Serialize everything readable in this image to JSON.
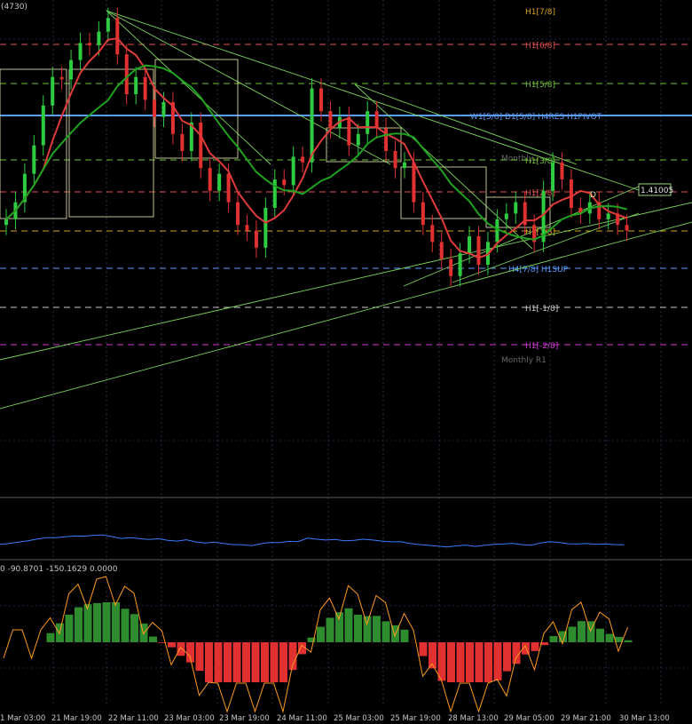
{
  "chart_data": {
    "type": "candlestick",
    "symbol_fragment": "(4730)",
    "price_marker": "1.41005",
    "osc_header": "0 -90.8701 -150.1629 0.0000",
    "x_ticks": [
      "1 Mar 03:00",
      "21 Mar 19:00",
      "22 Mar 11:00",
      "23 Mar 03:00",
      "23 Mar 19:00",
      "24 Mar 11:00",
      "25 Mar 03:00",
      "25 Mar 19:00",
      "28 Mar 13:00",
      "29 Mar 05:00",
      "29 Mar 21:00",
      "30 Mar 13:00"
    ],
    "levels": [
      {
        "label": "H1[7/8]",
        "color": "#d4a017",
        "style": "solid-grey"
      },
      {
        "label": "H1[6/8]",
        "color": "#e05050",
        "style": "dash"
      },
      {
        "label": "H1[5/8]",
        "color": "#6fbf3a",
        "style": "dash"
      },
      {
        "label": "W1[5/8] D1[5/8] H4RES H1PIVOT",
        "color": "#5a9cff",
        "style": "solid"
      },
      {
        "label": "Monthly",
        "color": "#666666",
        "style": "none"
      },
      {
        "label": "H1[3/8]",
        "color": "#6fbf3a",
        "style": "dash"
      },
      {
        "label": "H1[2/8]",
        "color": "#e05050",
        "style": "dash"
      },
      {
        "label": "H1[1/8]",
        "color": "#d4a017",
        "style": "dash"
      },
      {
        "label": "H4[7/8] H1SUP",
        "color": "#5a9cff",
        "style": "dash"
      },
      {
        "label": "H1[-1/8]",
        "color": "#c8c8c8",
        "style": "dash"
      },
      {
        "label": "H1[-2/8]",
        "color": "#d23ad2",
        "style": "dash"
      },
      {
        "label": "Monthly R1",
        "color": "#666666",
        "style": "none"
      }
    ],
    "d_marker": "D",
    "colors": {
      "bull": "#2ecc40",
      "bear": "#e03030",
      "ma_red": "#e03b3b",
      "ma_green": "#1fa31f",
      "trend": "#7bd35b",
      "box": "#d6d6a0",
      "rsi": "#3a7bff",
      "osc_pos": "#2e8b2e",
      "osc_neg": "#e03030",
      "osc_line": "#ff9a1f"
    },
    "series_close": [
      1.3995,
      1.401,
      1.4035,
      1.406,
      1.4095,
      1.412,
      1.4118,
      1.4135,
      1.415,
      1.4148,
      1.416,
      1.4172,
      1.414,
      1.4105,
      1.412,
      1.41,
      1.4085,
      1.4098,
      1.407,
      1.4055,
      1.408,
      1.404,
      1.402,
      1.4035,
      1.401,
      1.399,
      1.3985,
      1.397,
      1.4005,
      1.403,
      1.4025,
      1.405,
      1.4045,
      1.411,
      1.409,
      1.4075,
      1.4085,
      1.406,
      1.407,
      1.409,
      1.4075,
      1.4055,
      1.404,
      1.4045,
      1.401,
      1.399,
      1.3975,
      1.396,
      1.3945,
      1.3965,
      1.398,
      1.3955,
      1.3975,
      1.3995,
      1.4,
      1.401,
      1.399,
      1.3975,
      1.402,
      1.4045,
      1.403,
      1.4005,
      1.4,
      1.401,
      1.3995,
      1.4,
      1.399,
      1.3985
    ]
  }
}
